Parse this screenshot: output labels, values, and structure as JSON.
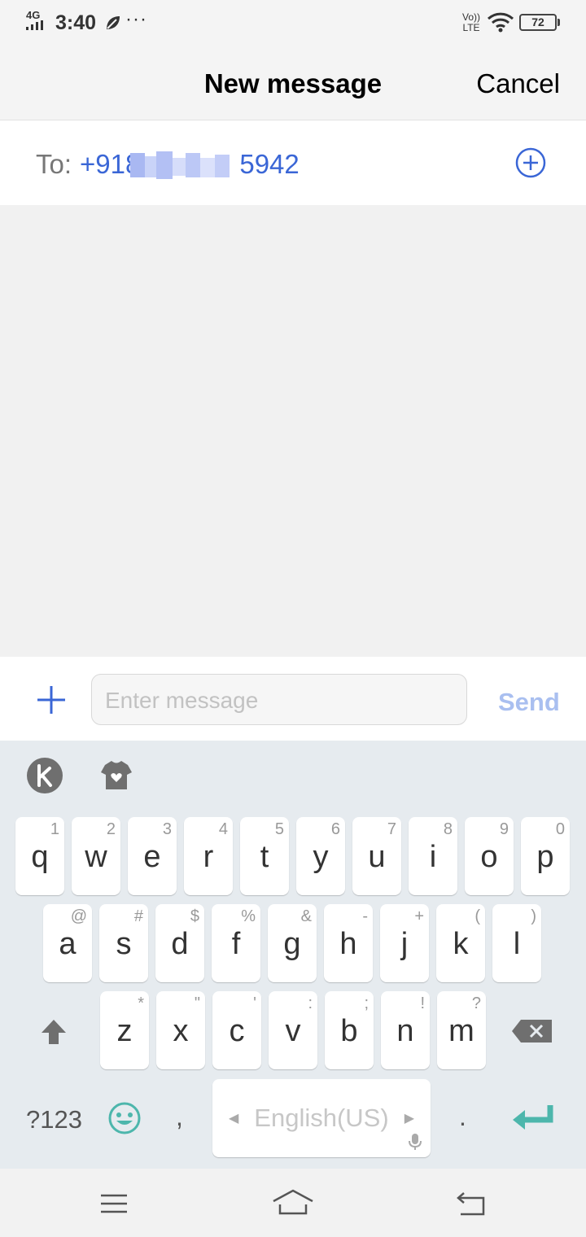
{
  "status_bar": {
    "network": "4G",
    "time": "3:40",
    "more": "···",
    "volte": "Vo)) LTE",
    "battery": "72"
  },
  "header": {
    "title": "New message",
    "cancel": "Cancel"
  },
  "recipient": {
    "label": "To:",
    "number_visible_prefix": "+918",
    "number_visible_suffix": "5942"
  },
  "compose": {
    "placeholder": "Enter message",
    "send": "Send"
  },
  "keyboard": {
    "row1": [
      {
        "main": "q",
        "sub": "1"
      },
      {
        "main": "w",
        "sub": "2"
      },
      {
        "main": "e",
        "sub": "3"
      },
      {
        "main": "r",
        "sub": "4"
      },
      {
        "main": "t",
        "sub": "5"
      },
      {
        "main": "y",
        "sub": "6"
      },
      {
        "main": "u",
        "sub": "7"
      },
      {
        "main": "i",
        "sub": "8"
      },
      {
        "main": "o",
        "sub": "9"
      },
      {
        "main": "p",
        "sub": "0"
      }
    ],
    "row2": [
      {
        "main": "a",
        "sub": "@"
      },
      {
        "main": "s",
        "sub": "#"
      },
      {
        "main": "d",
        "sub": "$"
      },
      {
        "main": "f",
        "sub": "%"
      },
      {
        "main": "g",
        "sub": "&"
      },
      {
        "main": "h",
        "sub": "-"
      },
      {
        "main": "j",
        "sub": "+"
      },
      {
        "main": "k",
        "sub": "("
      },
      {
        "main": "l",
        "sub": ")"
      }
    ],
    "row3": [
      {
        "main": "z",
        "sub": "*"
      },
      {
        "main": "x",
        "sub": "\""
      },
      {
        "main": "c",
        "sub": "'"
      },
      {
        "main": "v",
        "sub": ":"
      },
      {
        "main": "b",
        "sub": ";"
      },
      {
        "main": "n",
        "sub": "!"
      },
      {
        "main": "m",
        "sub": "?"
      }
    ],
    "numbers_key": "?123",
    "comma": ",",
    "space_label": "English(US)",
    "period": ".",
    "accent_color": "#4db6ac"
  },
  "colors": {
    "link_blue": "#3a66d6",
    "send_disabled": "#a9bff0"
  }
}
